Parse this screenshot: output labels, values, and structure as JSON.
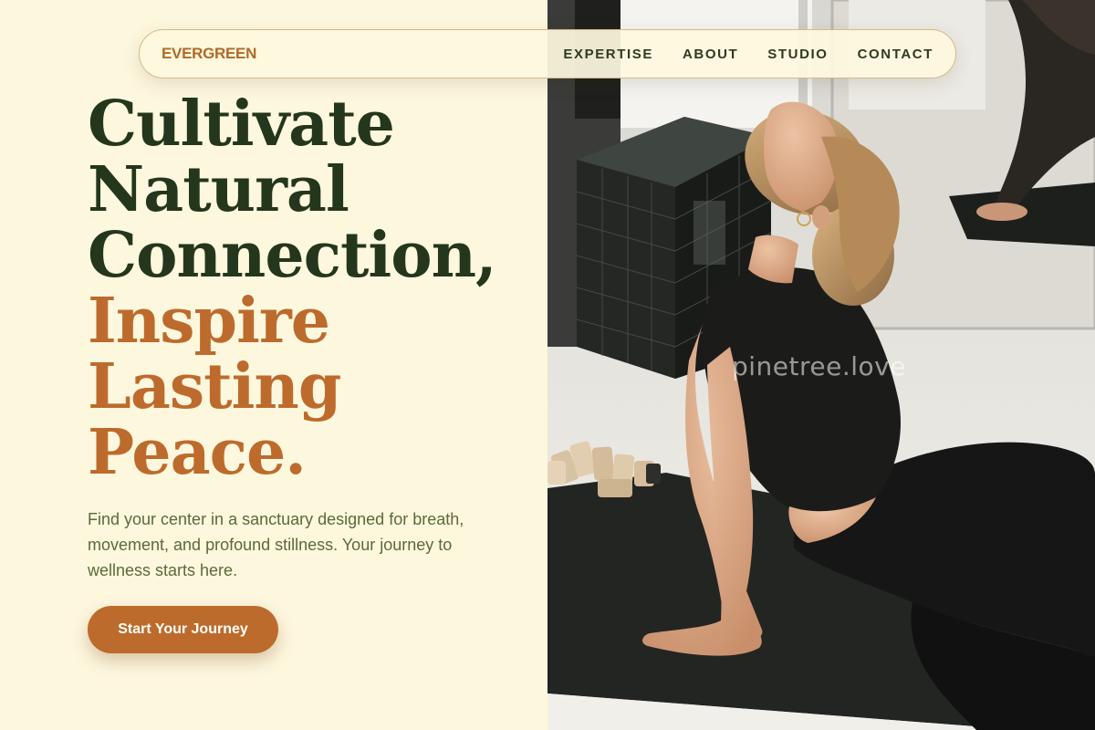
{
  "nav": {
    "brand": "EVERGREEN",
    "items": [
      {
        "label": "EXPERTISE"
      },
      {
        "label": "ABOUT"
      },
      {
        "label": "STUDIO"
      },
      {
        "label": "CONTACT"
      }
    ]
  },
  "hero": {
    "headline_dark": [
      "Cultivate",
      "Natural",
      "Connection,"
    ],
    "headline_accent": [
      "Inspire",
      "Lasting",
      "Peace."
    ],
    "subtext": "Find your center in a sanctuary designed for breath, movement, and profound stillness. Your journey to wellness starts here.",
    "cta_label": "Start Your Journey"
  },
  "photo": {
    "alt": "Woman in upward-facing dog yoga pose on a dark mat",
    "watermark": "pinetree.love"
  },
  "colors": {
    "background": "#fdf7de",
    "heading_dark": "#24361b",
    "accent": "#bd6b2c",
    "body_text": "#5a6a3b",
    "nav_text": "#2f3a22",
    "brand": "#b06a28"
  }
}
